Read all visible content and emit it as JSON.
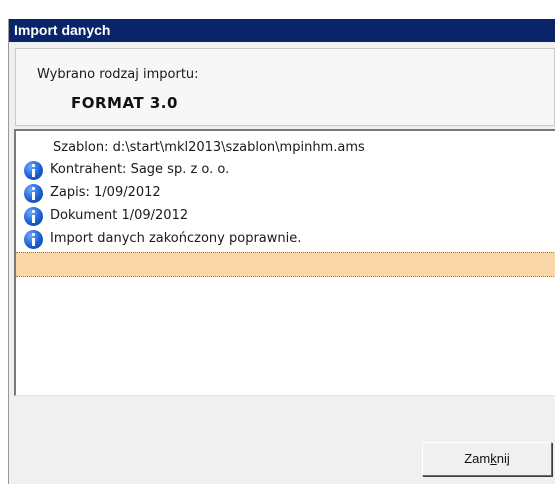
{
  "window": {
    "title": "Import danych"
  },
  "info": {
    "caption": "Wybrano rodzaj importu:",
    "format": "FORMAT 3.0"
  },
  "log": {
    "rows": [
      {
        "text": "Szablon: d:\\start\\mkl2013\\szablon\\mpinhm.ams",
        "icon": null
      },
      {
        "text": "Kontrahent: Sage sp. z o. o.",
        "icon": "info-icon"
      },
      {
        "text": "Zapis: 1/09/2012",
        "icon": "info-icon"
      },
      {
        "text": "Dokument 1/09/2012",
        "icon": "info-icon"
      },
      {
        "text": "Import danych zakończony poprawnie.",
        "icon": "info-icon"
      }
    ],
    "selected_row_color": "#f9d7a8"
  },
  "buttons": {
    "close_pre": "Zam",
    "close_mnemonic": "k",
    "close_post": "nij"
  },
  "colors": {
    "titlebar": "#0a246a",
    "info_icon": "#1b5fd1"
  }
}
